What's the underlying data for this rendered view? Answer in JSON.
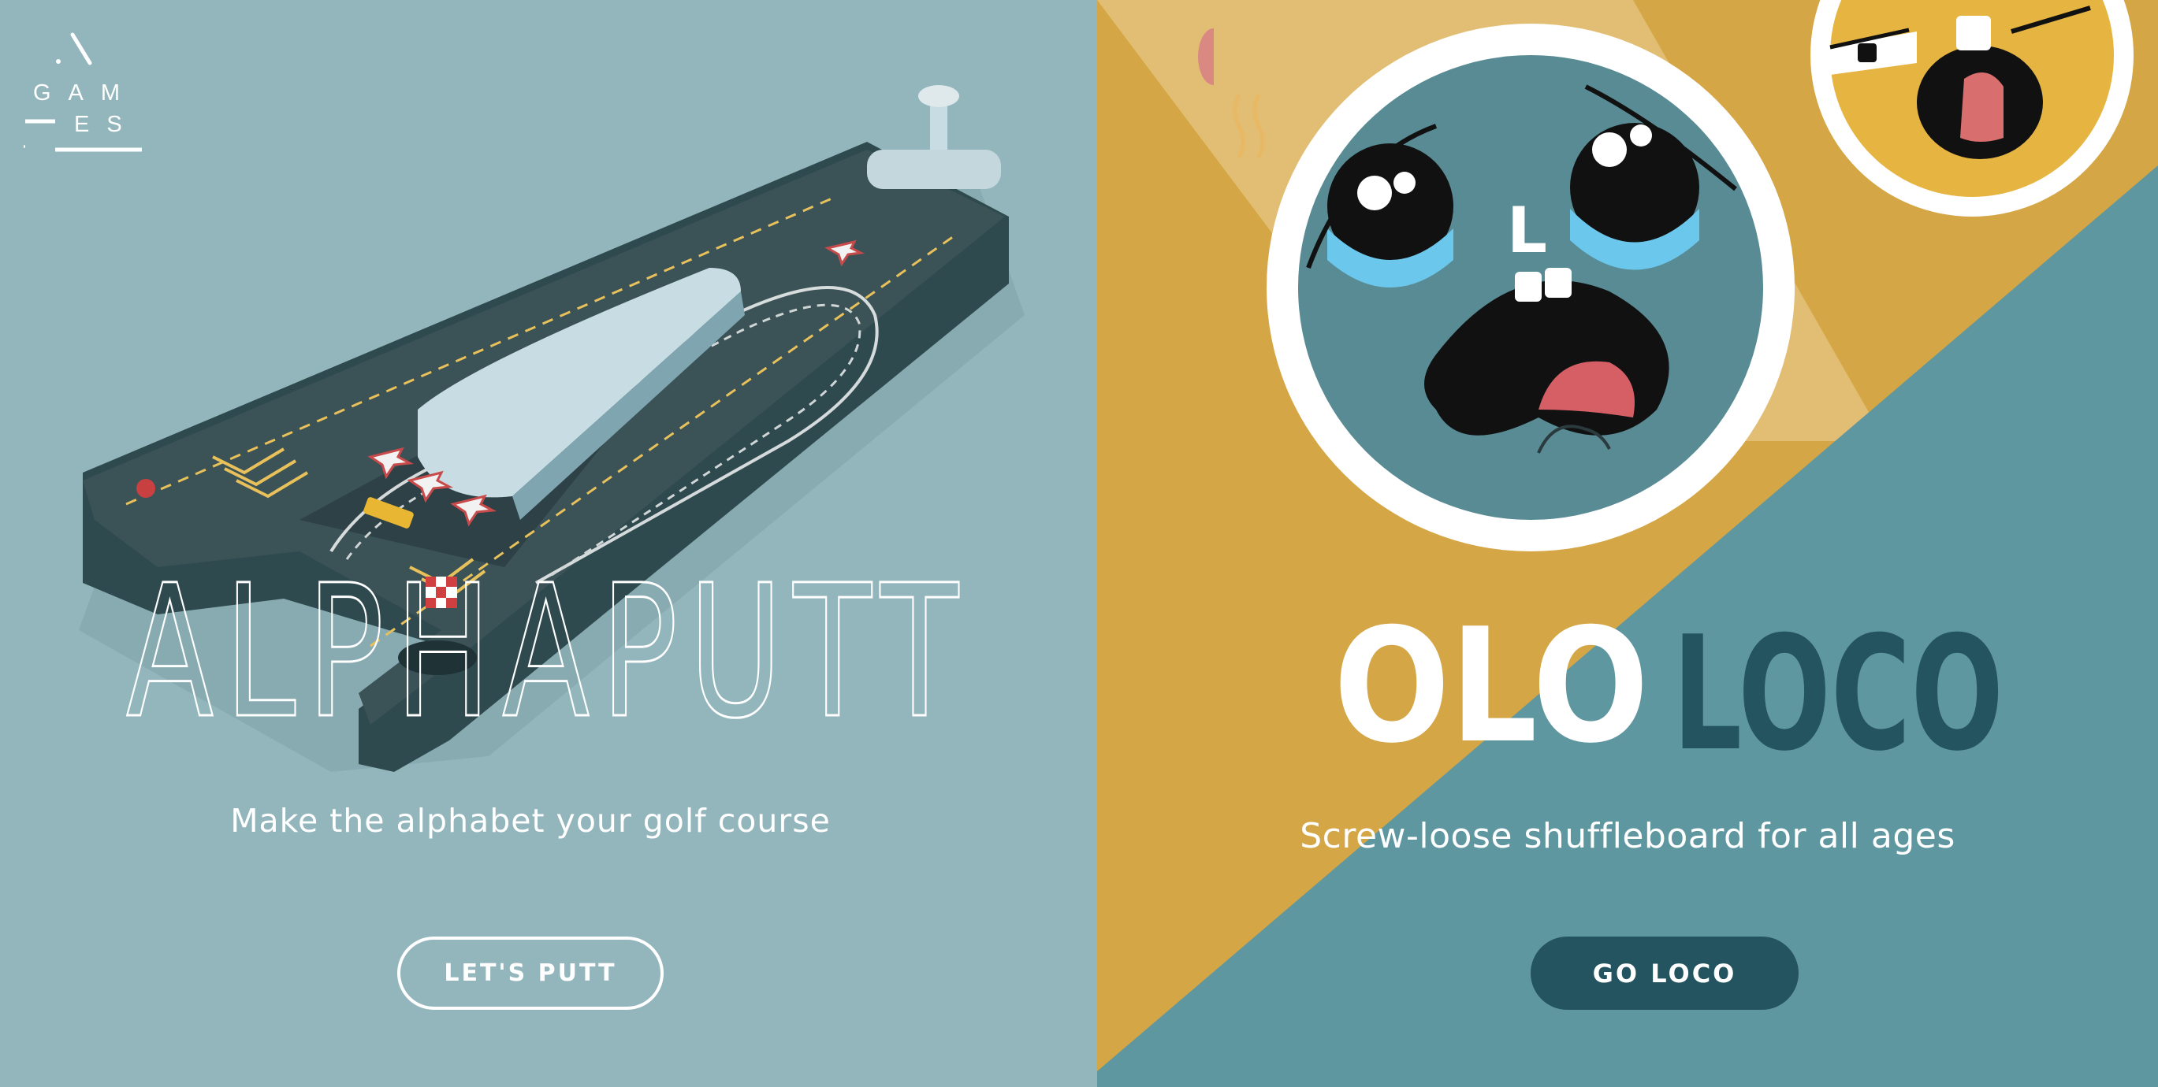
{
  "logo": {
    "row1": "GAM",
    "row2": "ES"
  },
  "alphaputt": {
    "title": "ALPHAPUTT",
    "tagline": "Make the alphabet your golf course",
    "button_label": "LET'S PUTT"
  },
  "ololoco": {
    "title_white": "OLO",
    "title_dark": "LOCO",
    "face_letter": "L",
    "tagline": "Screw-loose shuffleboard for all ages",
    "button_label": "GO LOCO"
  },
  "colors": {
    "left_bg": "#93b6bd",
    "right_yellow": "#d4a645",
    "right_teal": "#5f97a0",
    "dark_teal": "#245460",
    "face_blue": "#588b94"
  }
}
